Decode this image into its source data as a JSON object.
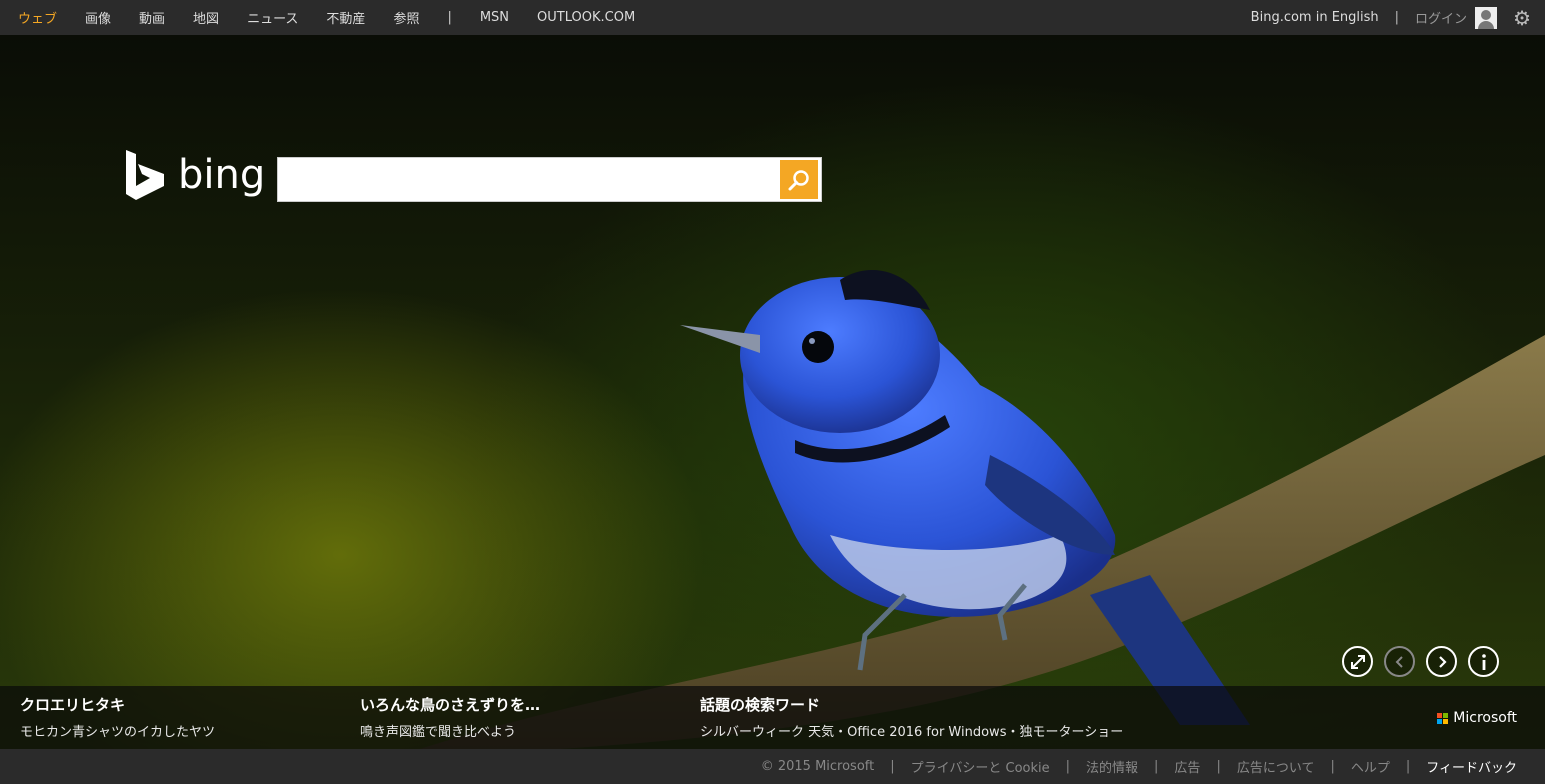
{
  "nav": {
    "items": [
      "ウェブ",
      "画像",
      "動画",
      "地図",
      "ニュース",
      "不動産",
      "参照"
    ],
    "separator": "|",
    "items2": [
      "MSN",
      "OUTLOOK.COM"
    ],
    "english_link": "Bing.com in English",
    "right_separator": "|",
    "login": "ログイン"
  },
  "logo": {
    "text": "bing"
  },
  "search": {
    "value": "",
    "placeholder": ""
  },
  "info": [
    {
      "title": "クロエリヒタキ",
      "subtitle": "モヒカン青シャツのイカしたヤツ"
    },
    {
      "title": "いろんな鳥のさえずりを…",
      "subtitle": "鳴き声図鑑で聞き比べよう"
    },
    {
      "title": "話題の検索ワード",
      "subtitle": "シルバーウィーク 天気・Office 2016 for Windows・独モーターショー"
    }
  ],
  "brand": {
    "microsoft": "Microsoft",
    "colors": [
      "#f25022",
      "#7fba00",
      "#00a4ef",
      "#ffb900"
    ]
  },
  "footer": {
    "copyright": "© 2015 Microsoft",
    "privacy": "プライバシーと Cookie",
    "legal": "法的情報",
    "ads": "広告",
    "about_ads": "広告について",
    "help": "ヘルプ",
    "feedback": "フィードバック",
    "separator": "|"
  },
  "colors": {
    "accent": "#f4a724",
    "topbar": "#2b2b2b",
    "bird": "#2b54d6"
  },
  "icons": [
    "user-icon",
    "gear-icon",
    "search-icon",
    "fullscreen-icon",
    "chevron-left-icon",
    "chevron-right-icon",
    "info-icon"
  ]
}
